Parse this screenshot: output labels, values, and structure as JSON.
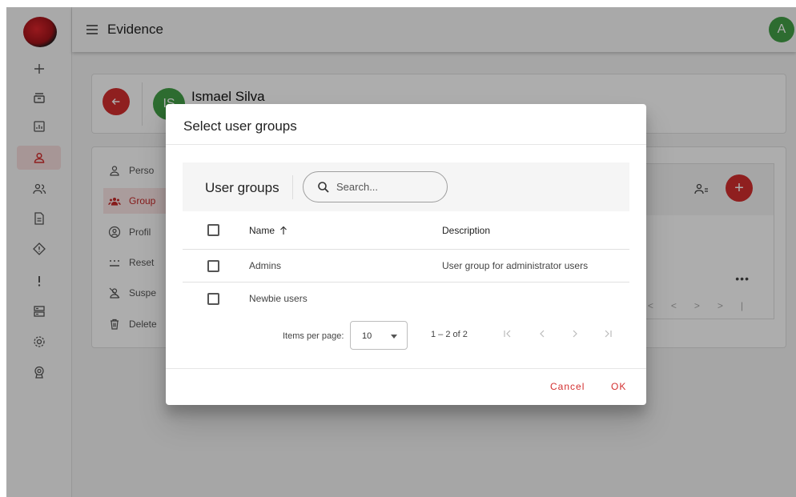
{
  "app": {
    "title": "Evidence",
    "user_initial": "A"
  },
  "sidebar": {
    "items": [
      {
        "icon": "plus-icon"
      },
      {
        "icon": "inbox-icon"
      },
      {
        "icon": "chart-icon"
      },
      {
        "icon": "person-icon",
        "active": true
      },
      {
        "icon": "group-icon"
      },
      {
        "icon": "document-icon"
      },
      {
        "icon": "diamond-alert-icon"
      },
      {
        "icon": "exclamation-icon"
      },
      {
        "icon": "storage-icon"
      },
      {
        "icon": "gear-icon"
      },
      {
        "icon": "badge-icon"
      }
    ]
  },
  "user": {
    "initials": "IS",
    "name": "Ismael Silva"
  },
  "user_menu": {
    "items": [
      {
        "label": "Perso",
        "icon": "person-outline-icon"
      },
      {
        "label": "Group",
        "icon": "groups-icon",
        "active": true
      },
      {
        "label": "Profil",
        "icon": "profile-icon"
      },
      {
        "label": "Reset",
        "icon": "password-icon"
      },
      {
        "label": "Suspe",
        "icon": "person-off-icon"
      },
      {
        "label": "Delete",
        "icon": "trash-icon"
      }
    ]
  },
  "dialog": {
    "title": "Select user groups",
    "table_title": "User groups",
    "search_placeholder": "Search...",
    "columns": {
      "name": "Name",
      "description": "Description"
    },
    "rows": [
      {
        "name": "Admins",
        "description": "User group for administrator users"
      },
      {
        "name": "Newbie users",
        "description": ""
      }
    ],
    "paginator": {
      "items_per_page_label": "Items per page:",
      "items_per_page_value": "10",
      "range": "1 – 2 of 2"
    },
    "cancel_label": "Cancel",
    "ok_label": "OK"
  },
  "colors": {
    "accent": "#d32f2f",
    "avatar": "#43a047"
  }
}
